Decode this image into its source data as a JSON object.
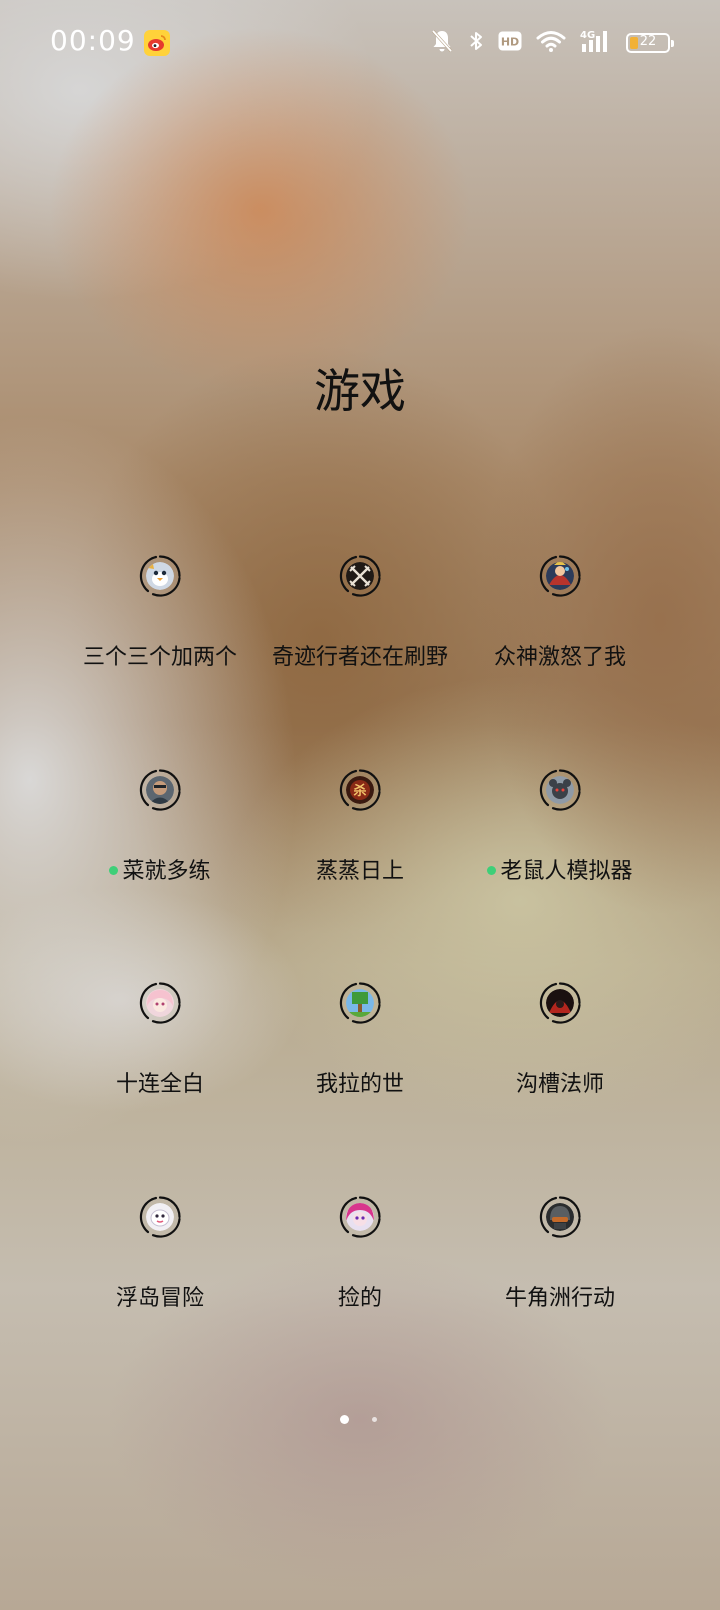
{
  "status_bar": {
    "time": "00:09",
    "notification_icon": "weibo-app-icon",
    "icons": [
      "bell-off-icon",
      "bluetooth-icon",
      "hd-icon",
      "wifi-icon",
      "4g-signal-icon"
    ],
    "hd_label": "HD",
    "network_label": "4G",
    "battery_level": "22",
    "battery_fraction": 0.22,
    "battery_color": "#f2b136"
  },
  "folder": {
    "title": "游戏"
  },
  "apps": [
    {
      "label": "三个三个加两个",
      "dot": false,
      "icon": "penguin-character-icon"
    },
    {
      "label": "奇迹行者还在刷野",
      "dot": false,
      "icon": "crossed-swords-icon"
    },
    {
      "label": "众神激怒了我",
      "dot": false,
      "icon": "god-character-icon"
    },
    {
      "label": "菜就多练",
      "dot": true,
      "icon": "soldier-portrait-icon"
    },
    {
      "label": "蒸蒸日上",
      "dot": false,
      "icon": "kill-emblem-icon"
    },
    {
      "label": "老鼠人模拟器",
      "dot": true,
      "icon": "rat-warrior-icon"
    },
    {
      "label": "十连全白",
      "dot": false,
      "icon": "anime-girl-icon"
    },
    {
      "label": "我拉的世",
      "dot": false,
      "icon": "tree-pixel-icon"
    },
    {
      "label": "沟槽法师",
      "dot": false,
      "icon": "red-hood-icon"
    },
    {
      "label": "浮岛冒险",
      "dot": false,
      "icon": "white-creature-icon"
    },
    {
      "label": "捡的",
      "dot": false,
      "icon": "pink-hair-girl-icon"
    },
    {
      "label": "牛角洲行动",
      "dot": false,
      "icon": "operator-helmet-icon"
    }
  ],
  "colors": {
    "new_dot": "#3ecf78"
  },
  "page_indicator": {
    "pages": 2,
    "active": 1
  }
}
